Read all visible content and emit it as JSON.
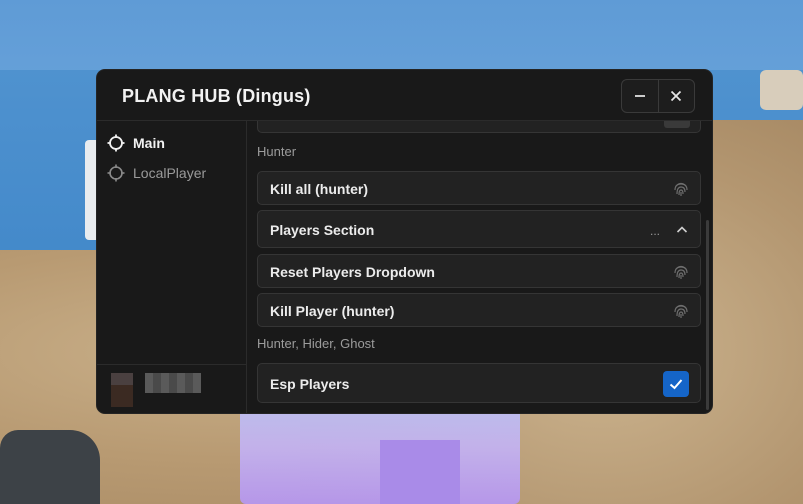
{
  "window": {
    "title": "PLANG HUB (Dingus)"
  },
  "sidebar": {
    "items": [
      {
        "label": "Main",
        "icon": "crosshair-icon",
        "active": true
      },
      {
        "label": "LocalPlayer",
        "icon": "crosshair-icon",
        "active": false
      }
    ]
  },
  "content": {
    "sections": [
      {
        "label": "Hunter"
      },
      {
        "label": "Hunter, Hider, Ghost"
      }
    ],
    "rows": {
      "kill_all": {
        "label": "Kill all (hunter)",
        "icon": "fingerprint-icon"
      },
      "players_section": {
        "label": "Players Section",
        "dots": "...",
        "icon": "chevron-up-icon"
      },
      "reset_players": {
        "label": "Reset Players Dropdown",
        "icon": "fingerprint-icon"
      },
      "kill_player": {
        "label": "Kill Player (hunter)",
        "icon": "fingerprint-icon"
      },
      "esp_players": {
        "label": "Esp Players",
        "checked": true,
        "icon": "check-icon"
      }
    }
  },
  "colors": {
    "accent": "#1565c8",
    "window_bg": "#191919",
    "row_bg": "#222222"
  }
}
